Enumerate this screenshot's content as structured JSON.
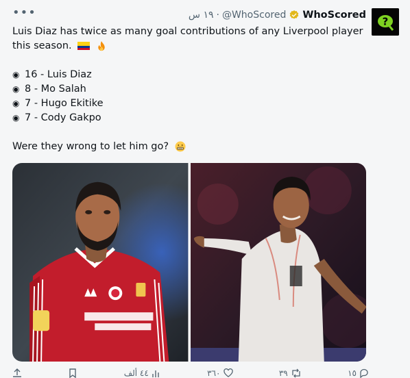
{
  "tweet": {
    "author_name": "WhoScored",
    "author_handle": "@WhoScored",
    "timestamp": "١٩ س",
    "separator": "·",
    "text_line1": "Luis Diaz has twice as many goal contributions of any Liverpool player this season.",
    "stats": [
      "16 - Luis Diaz",
      "8 - Mo Salah",
      "7 - Hugo Ekitike",
      "7 - Cody Gakpo"
    ],
    "question": "Were they wrong to let him go?",
    "bullet_icon": "radio-bullet-icon",
    "flag_icon": "colombia-flag-icon",
    "fire_icon": "fire-icon",
    "emoji_icon": "grimacing-face-icon"
  },
  "media": {
    "left_photo": "salah-liverpool-photo",
    "right_photo": "diaz-bayern-photo"
  },
  "actions": {
    "reply_count": "١٥",
    "retweet_count": "٣٩",
    "like_count": "٣٦٠",
    "views_count": "٤٤ ألف"
  },
  "colors": {
    "accent": "#1d9bf0",
    "verified": "#e2b719",
    "liverpool_red": "#c8102e",
    "bayern_white": "#e9e6e3"
  }
}
